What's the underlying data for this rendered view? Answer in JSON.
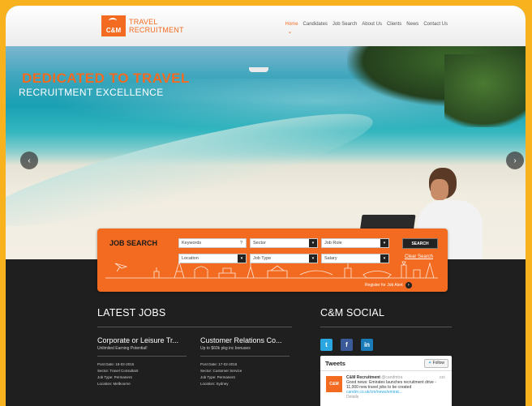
{
  "header": {
    "logo_mark": "C&M",
    "logo_line1": "TRAVEL",
    "logo_line2": "RECRUITMENT",
    "nav": [
      "Home",
      "Candidates",
      "Job Search",
      "About Us",
      "Clients",
      "News",
      "Contact Us"
    ],
    "active_nav": "Home"
  },
  "hero": {
    "headline": "DEDICATED TO TRAVEL",
    "subheadline": "RECRUITMENT EXCELLENCE",
    "prev_icon": "‹",
    "next_icon": "›"
  },
  "job_search": {
    "title": "JOB SEARCH",
    "keywords_placeholder": "Keywords",
    "keywords_help": "?",
    "sector": "Sector",
    "job_role": "Job Role",
    "location": "Location",
    "job_type": "Job Type",
    "salary": "Salary",
    "button": "SEARCH",
    "clear": "Clear Search",
    "register": "Register for Job Alert",
    "register_icon": "›",
    "dropdown_icon": "▾"
  },
  "latest_jobs": {
    "title": "LATEST JOBS",
    "jobs": [
      {
        "title": "Corporate or Leisure Tr...",
        "subtitle": "Unlimited Earning Potential!",
        "post_date": "Post Date: 18-02-2015",
        "sector": "Sector: Travel Consultant",
        "job_type": "Job Type: Permanent",
        "location": "Location: Melbourne"
      },
      {
        "title": "Customer Relations Co...",
        "subtitle": "Up to $60k pkg inc bonuses",
        "post_date": "Post Date: 17-02-2015",
        "sector": "Sector: Customer Service",
        "job_type": "Job Type: Permanent",
        "location": "Location: Sydney"
      }
    ]
  },
  "social": {
    "title": "C&M SOCIAL",
    "twitter": "t",
    "facebook": "f",
    "linkedin": "in",
    "colors": {
      "twitter": "#2aa7e0",
      "facebook": "#3b5a9a",
      "linkedin": "#1a7bb9"
    },
    "tweets_header": "Tweets",
    "follow": "Follow",
    "tweet_user": "C&M Recruitment",
    "tweet_handle": "@candmtra",
    "tweet_time": "23h",
    "tweet_text": "Good news: Emirates launches recruitment drive - 11,000 new travel jobs to be created",
    "tweet_link": "candm.co.uk/cm/news/emirat...",
    "tweet_sub": "Details"
  },
  "colors": {
    "brand": "#f26b21",
    "background": "#f7b21e",
    "dark": "#1f1f1f"
  }
}
